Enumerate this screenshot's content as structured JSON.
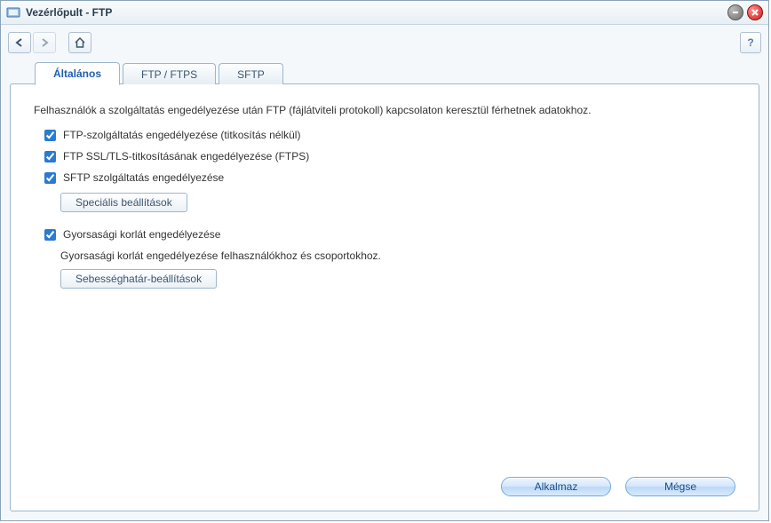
{
  "window": {
    "title": "Vezérlőpult - FTP"
  },
  "tabs": [
    {
      "label": "Általános",
      "active": true
    },
    {
      "label": "FTP / FTPS",
      "active": false
    },
    {
      "label": "SFTP",
      "active": false
    }
  ],
  "general": {
    "description": "Felhasználók a szolgáltatás engedélyezése után FTP (fájlátviteli protokoll) kapcsolaton keresztül férhetnek adatokhoz.",
    "checks": {
      "ftp_plain": {
        "label": "FTP-szolgáltatás engedélyezése (titkosítás nélkül)",
        "checked": true
      },
      "ftps": {
        "label": "FTP SSL/TLS-titkosításának engedélyezése (FTPS)",
        "checked": true
      },
      "sftp": {
        "label": "SFTP szolgáltatás engedélyezése",
        "checked": true
      },
      "speed": {
        "label": "Gyorsasági korlát engedélyezése",
        "checked": true
      }
    },
    "advanced_btn": "Speciális beállítások",
    "speed_sub": "Gyorsasági korlát engedélyezése felhasználókhoz és csoportokhoz.",
    "speed_btn": "Sebességhatár-beállítások"
  },
  "footer": {
    "apply": "Alkalmaz",
    "cancel": "Mégse"
  },
  "help": "?"
}
